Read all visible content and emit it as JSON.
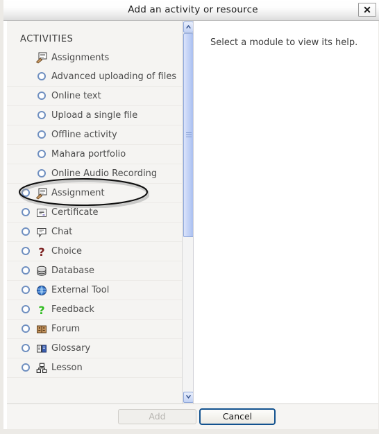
{
  "dialog": {
    "title": "Add an activity or resource",
    "close_icon": "close-icon"
  },
  "left_panel": {
    "section_title": "ACTIVITIES",
    "items": [
      {
        "label": "Assignments",
        "kind": "header",
        "icon": "assignment-icon"
      },
      {
        "label": "Advanced uploading of files",
        "kind": "sub"
      },
      {
        "label": "Online text",
        "kind": "sub"
      },
      {
        "label": "Upload a single file",
        "kind": "sub"
      },
      {
        "label": "Offline activity",
        "kind": "sub"
      },
      {
        "label": "Mahara portfolio",
        "kind": "sub",
        "highlighted": true
      },
      {
        "label": "Online Audio Recording",
        "kind": "sub"
      },
      {
        "label": "Assignment",
        "kind": "top",
        "icon": "assignment-icon"
      },
      {
        "label": "Certificate",
        "kind": "top",
        "icon": "certificate-icon"
      },
      {
        "label": "Chat",
        "kind": "top",
        "icon": "chat-icon"
      },
      {
        "label": "Choice",
        "kind": "top",
        "icon": "choice-icon"
      },
      {
        "label": "Database",
        "kind": "top",
        "icon": "database-icon"
      },
      {
        "label": "External Tool",
        "kind": "top",
        "icon": "globe-icon"
      },
      {
        "label": "Feedback",
        "kind": "top",
        "icon": "feedback-icon"
      },
      {
        "label": "Forum",
        "kind": "top",
        "icon": "forum-icon"
      },
      {
        "label": "Glossary",
        "kind": "top",
        "icon": "glossary-icon"
      },
      {
        "label": "Lesson",
        "kind": "top",
        "icon": "lesson-icon"
      }
    ]
  },
  "right_panel": {
    "help_text": "Select a module to view its help."
  },
  "scrollbar": {
    "up_icon": "chevron-up-icon",
    "down_icon": "chevron-down-icon"
  },
  "footer": {
    "add_label": "Add",
    "cancel_label": "Cancel"
  },
  "colors": {
    "accent_blue": "#12528f",
    "radio_blue": "#6f8fc0",
    "panel_bg": "#f5f4f2",
    "scroll_thumb": "#b9cbf4"
  }
}
